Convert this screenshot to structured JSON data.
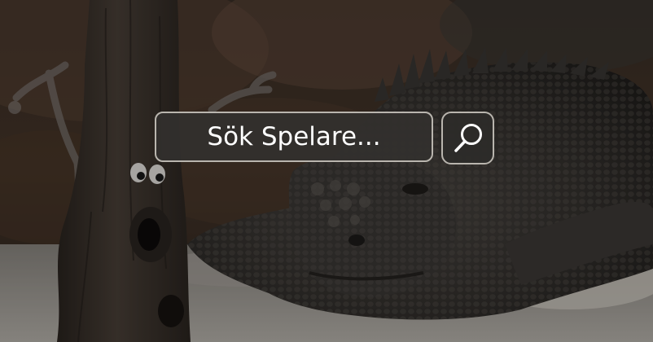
{
  "search": {
    "placeholder": "Sök Spelare...",
    "value": "",
    "button_icon": "search-icon"
  },
  "background": {
    "scene": "iguana-and-tree-photo"
  },
  "colors": {
    "field_border": "#b9b5ae",
    "field_fill": "#32302e",
    "text": "#ffffff"
  }
}
